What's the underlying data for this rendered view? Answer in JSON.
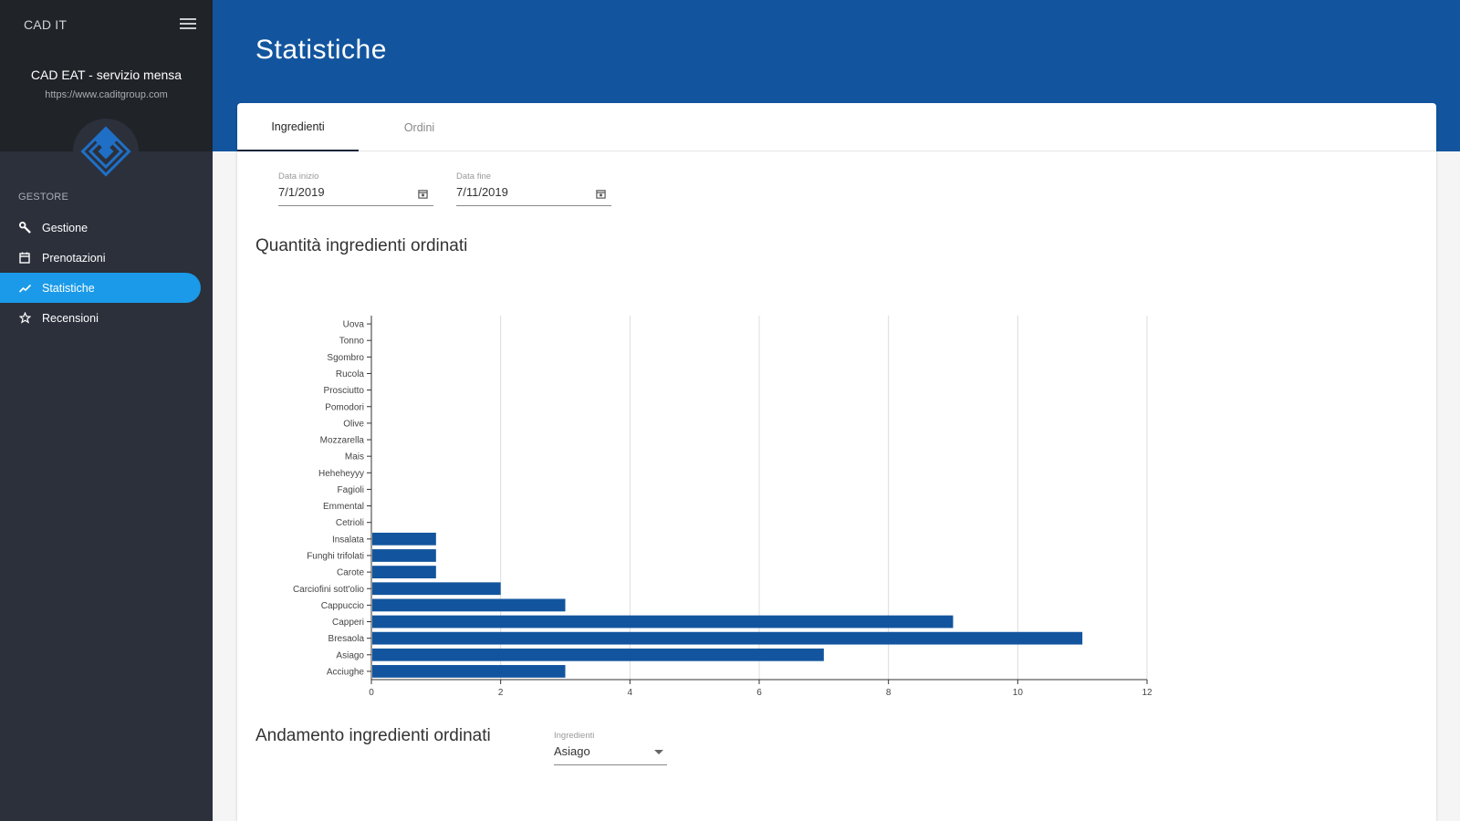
{
  "sidebar": {
    "brand": "CAD IT",
    "app_name": "CAD EAT - servizio mensa",
    "app_url": "https://www.caditgroup.com",
    "section_label": "GESTORE",
    "items": [
      {
        "label": "Gestione",
        "icon": "wrench-icon"
      },
      {
        "label": "Prenotazioni",
        "icon": "calendar-icon"
      },
      {
        "label": "Statistiche",
        "icon": "trending-up-icon",
        "active": true
      },
      {
        "label": "Recensioni",
        "icon": "star-icon"
      }
    ]
  },
  "header": {
    "title": "Statistiche"
  },
  "tabs": [
    {
      "label": "Ingredienti",
      "active": true
    },
    {
      "label": "Ordini",
      "active": false
    }
  ],
  "filters": {
    "start": {
      "label": "Data inizio",
      "value": "7/1/2019"
    },
    "end": {
      "label": "Data fine",
      "value": "7/11/2019"
    }
  },
  "sections": {
    "quantity_title": "Quantità ingredienti ordinati",
    "trend_title": "Andamento ingredienti ordinati"
  },
  "ingredient_select": {
    "label": "Ingredienti",
    "value": "Asiago"
  },
  "colors": {
    "header": "#12559e",
    "sidebar": "#2b303b",
    "active_nav": "#1a9ae8",
    "bar": "#12559e"
  },
  "chart_data": {
    "type": "bar",
    "orientation": "horizontal",
    "categories": [
      "Uova",
      "Tonno",
      "Sgombro",
      "Rucola",
      "Prosciutto",
      "Pomodori",
      "Olive",
      "Mozzarella",
      "Mais",
      "Heheheyyy",
      "Fagioli",
      "Emmental",
      "Cetrioli",
      "Insalata",
      "Funghi trifolati",
      "Carote",
      "Carciofini sott'olio",
      "Cappuccio",
      "Capperi",
      "Bresaola",
      "Asiago",
      "Acciughe"
    ],
    "values": [
      0,
      0,
      0,
      0,
      0,
      0,
      0,
      0,
      0,
      0,
      0,
      0,
      0,
      1,
      1,
      1,
      2,
      3,
      9,
      11,
      7,
      3
    ],
    "xlim": [
      0,
      12
    ],
    "xticks": [
      0,
      2,
      4,
      6,
      8,
      10,
      12
    ],
    "grid": true,
    "title": "",
    "xlabel": "",
    "ylabel": ""
  }
}
